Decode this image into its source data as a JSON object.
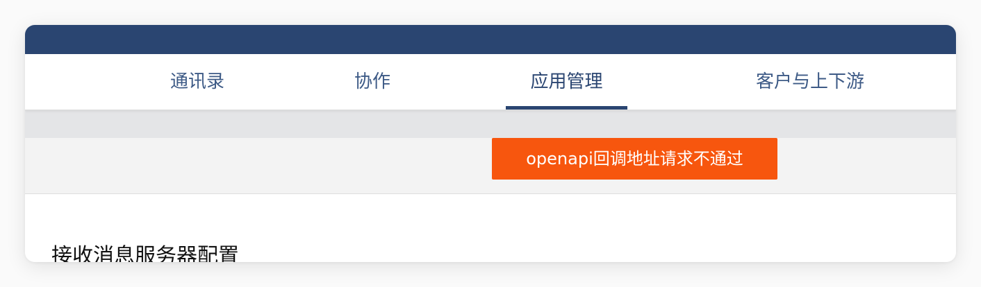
{
  "tabs": [
    {
      "label": "通讯录",
      "active": false
    },
    {
      "label": "协作",
      "active": false
    },
    {
      "label": "应用管理",
      "active": true
    },
    {
      "label": "客户与上下游",
      "active": false
    }
  ],
  "alert": {
    "message": "openapi回调地址请求不通过"
  },
  "section": {
    "title": "接收消息服务器配置"
  },
  "colors": {
    "header": "#2a4571",
    "alert": "#f7560e"
  }
}
